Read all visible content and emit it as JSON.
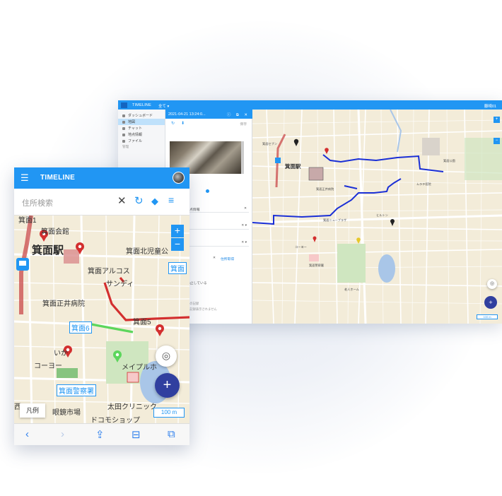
{
  "desktop": {
    "topbar": {
      "title": "TIMELINE",
      "filter_label": "全て ▾",
      "user_label": "藤崎01"
    },
    "sidebar": {
      "items": [
        {
          "label": "ダッシュボード",
          "icon": "dashboard-icon"
        },
        {
          "label": "地図",
          "icon": "map-icon",
          "active": true
        },
        {
          "label": "チャット",
          "icon": "chat-icon"
        },
        {
          "label": "地点情報",
          "icon": "pin-icon"
        },
        {
          "label": "ファイル",
          "icon": "folder-icon"
        }
      ],
      "section_label": "管理"
    },
    "panel": {
      "header_title": "2021-04-21 13:24:0...",
      "header_icons": "ⓘ ⧉ ✕",
      "action_label": "保存",
      "row_time": "11 13:24:55 発点情報",
      "row_name": "箕面駅 箕面 5",
      "row_name_link": "住所取得",
      "row_text": "休止している",
      "note_1": "人の記録",
      "note_2": "の記録表示されません"
    },
    "map": {
      "labels": {
        "station": "箕面駅",
        "pharmacy": "箕面セブン",
        "school": "箕面ニュープラザ",
        "clinic": "ムラテ医院",
        "hospital": "箕面正井病院",
        "park": "箕面公園",
        "shop": "ヒルトン",
        "police": "箕面警察署",
        "mart": "コーヨー",
        "care": "老人ホーム"
      },
      "scale_label": "100 m"
    }
  },
  "mobile": {
    "topbar": {
      "title": "TIMELINE"
    },
    "search": {
      "placeholder": "住所検索"
    },
    "map": {
      "labels": {
        "mino1": "箕面1",
        "kaikan": "箕面会館",
        "station": "箕面駅",
        "park": "箕面北児童公",
        "arcos": "箕面アルコス",
        "sundy": "サンディ",
        "hospital": "箕面正井病院",
        "mino5": "箕面5",
        "mino6": "箕面6",
        "ikari": "いか",
        "koyo": "コーヨー",
        "maple": "メイプルホ",
        "police": "箕面警察署",
        "west": "西",
        "megane": "眼鏡市場",
        "ota": "太田クリニック",
        "docomo": "ドコモショップ",
        "sidebox": "箕面"
      },
      "legend_label": "凡例",
      "scale_label": "100 m"
    },
    "bottom_bar": [
      "back-icon",
      "forward-icon",
      "share-icon",
      "bookmarks-icon",
      "tabs-icon"
    ]
  },
  "colors": {
    "accent": "#2196f3",
    "fab": "#303f9f",
    "route_red": "#d32f2f",
    "route_blue": "#1a2fd6",
    "route_green": "#5cd65c"
  }
}
